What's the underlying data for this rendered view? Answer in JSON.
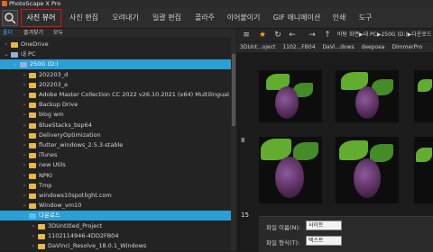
{
  "app": {
    "title": "PhotoScape X Pro"
  },
  "menu": {
    "tabs": [
      "사진 뷰어",
      "사진 편집",
      "오려내기",
      "일괄 편집",
      "콜라주",
      "이어붙이기",
      "GIF 애니메이션",
      "인쇄",
      "도구"
    ]
  },
  "sidebar": {
    "tabs": [
      "폴더",
      "즐겨찾기",
      "모두"
    ],
    "tree": [
      {
        "label": "OneDrive",
        "indent": 1,
        "arrow": "›",
        "kind": "folder"
      },
      {
        "label": "내 PC",
        "indent": 1,
        "arrow": "⌄",
        "kind": "drive"
      },
      {
        "label": "250G (D:)",
        "indent": 2,
        "arrow": "⌄",
        "kind": "drive",
        "selected": true
      },
      {
        "label": "202203_d",
        "indent": 3,
        "arrow": "›",
        "kind": "folder"
      },
      {
        "label": "202203_e",
        "indent": 3,
        "arrow": "›",
        "kind": "folder"
      },
      {
        "label": "Adobe Master Collection CC 2022 v26.10.2021 (x64) Multilingual",
        "indent": 3,
        "arrow": "›",
        "kind": "folder"
      },
      {
        "label": "Backup Drive",
        "indent": 3,
        "arrow": "›",
        "kind": "folder"
      },
      {
        "label": "blog wm",
        "indent": 3,
        "arrow": "›",
        "kind": "folder"
      },
      {
        "label": "BlueStacks_bsp64",
        "indent": 3,
        "arrow": "›",
        "kind": "folder"
      },
      {
        "label": "DeliveryOptimization",
        "indent": 3,
        "arrow": "›",
        "kind": "folder"
      },
      {
        "label": "flutter_windows_2.5.3-stable",
        "indent": 3,
        "arrow": "›",
        "kind": "folder"
      },
      {
        "label": "iTunes",
        "indent": 3,
        "arrow": "›",
        "kind": "folder"
      },
      {
        "label": "new Utils",
        "indent": 3,
        "arrow": "›",
        "kind": "folder"
      },
      {
        "label": "NPKI",
        "indent": 3,
        "arrow": "›",
        "kind": "folder"
      },
      {
        "label": "Tmp",
        "indent": 3,
        "arrow": "›",
        "kind": "folder"
      },
      {
        "label": "windows10spotlight.com",
        "indent": 3,
        "arrow": "›",
        "kind": "folder"
      },
      {
        "label": "Window_vm10",
        "indent": 3,
        "arrow": "›",
        "kind": "folder"
      },
      {
        "label": "다운로드",
        "indent": 3,
        "arrow": "⌄",
        "kind": "download",
        "selected": true
      },
      {
        "label": "3DUntitled_Project",
        "indent": 4,
        "arrow": "›",
        "kind": "folder"
      },
      {
        "label": "1102114946-4DD2FB04",
        "indent": 4,
        "arrow": "›",
        "kind": "folder"
      },
      {
        "label": "DaVinci_Resolve_18.0.1_Windows",
        "indent": 4,
        "arrow": "›",
        "kind": "folder"
      }
    ]
  },
  "viewer": {
    "path": "바탕 화면▶내 PC▶250G (D:)▶다운로드",
    "crumbs": [
      "3DUnt...oject",
      "1102...FB04",
      "DaVi...dows",
      "deepoea",
      "DimmerPro"
    ],
    "numbers": [
      "8",
      "15"
    ],
    "panel": {
      "file_name_label": "파일 이름(N):",
      "file_name_value": "사이트",
      "file_type_label": "파일 형식(T):",
      "file_type_value": "텍스트"
    }
  },
  "colors": {
    "accent": "#2a9fd6",
    "star": "#f5a623",
    "active_tab_border": "#dd1111"
  }
}
